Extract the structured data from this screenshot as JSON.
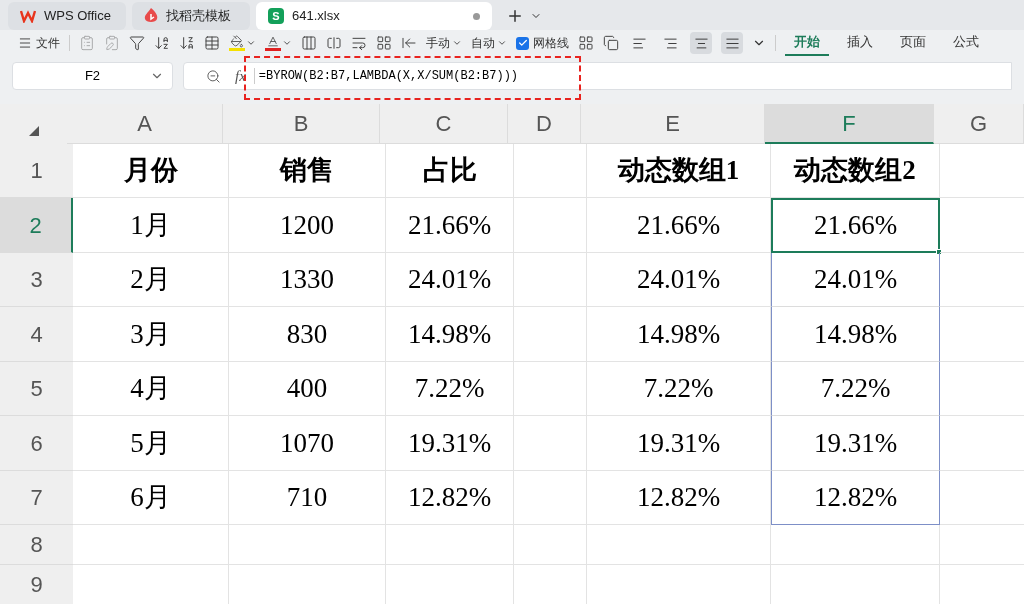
{
  "tabs": [
    {
      "label": "WPS Office",
      "kind": "wps",
      "selected": false
    },
    {
      "label": "找稻壳模板",
      "kind": "docer",
      "selected": false
    },
    {
      "label": "641.xlsx",
      "kind": "sheet",
      "selected": true,
      "icon_letter": "S"
    }
  ],
  "toolbar": {
    "file_label": "文件",
    "row_height_label": "手动",
    "col_width_label": "自动",
    "gridlines": {
      "label": "网格线",
      "checked": true
    },
    "align": [
      {
        "kind": "left",
        "selected": false
      },
      {
        "kind": "right",
        "selected": false
      },
      {
        "kind": "center",
        "selected": true
      },
      {
        "kind": "middle",
        "selected": true
      }
    ],
    "ribbon_tabs": [
      {
        "label": "开始",
        "selected": true
      },
      {
        "label": "插入",
        "selected": false
      },
      {
        "label": "页面",
        "selected": false
      },
      {
        "label": "公式",
        "selected": false
      }
    ]
  },
  "formula_bar": {
    "name_box": "F2",
    "function_label": "fx",
    "formula": "=BYROW(B2:B7,LAMBDA(X,X/SUM(B2:B7)))"
  },
  "columns": [
    {
      "label": "A",
      "selected": false
    },
    {
      "label": "B",
      "selected": false
    },
    {
      "label": "C",
      "selected": false
    },
    {
      "label": "D",
      "selected": false
    },
    {
      "label": "E",
      "selected": false
    },
    {
      "label": "F",
      "selected": true
    },
    {
      "label": "G",
      "selected": false
    }
  ],
  "rows": [
    {
      "label": "1",
      "selected": false,
      "spill": false,
      "cells": [
        "月份",
        "销售",
        "占比",
        null,
        "动态数组1",
        "动态数组2",
        null
      ]
    },
    {
      "label": "2",
      "selected": true,
      "spill": true,
      "cells": [
        "1月",
        "1200",
        "21.66%",
        null,
        "21.66%",
        "21.66%",
        null
      ]
    },
    {
      "label": "3",
      "selected": false,
      "spill": true,
      "cells": [
        "2月",
        "1330",
        "24.01%",
        null,
        "24.01%",
        "24.01%",
        null
      ]
    },
    {
      "label": "4",
      "selected": false,
      "spill": true,
      "cells": [
        "3月",
        "830",
        "14.98%",
        null,
        "14.98%",
        "14.98%",
        null
      ]
    },
    {
      "label": "5",
      "selected": false,
      "spill": true,
      "cells": [
        "4月",
        "400",
        "7.22%",
        null,
        "7.22%",
        "7.22%",
        null
      ]
    },
    {
      "label": "6",
      "selected": false,
      "spill": true,
      "cells": [
        "5月",
        "1070",
        "19.31%",
        null,
        "19.31%",
        "19.31%",
        null
      ]
    },
    {
      "label": "7",
      "selected": false,
      "spill": true,
      "cells": [
        "6月",
        "710",
        "12.82%",
        null,
        "12.82%",
        "12.82%",
        null
      ]
    },
    {
      "label": "8",
      "selected": false,
      "spill": false
    },
    {
      "label": "9",
      "selected": false,
      "spill": false
    }
  ]
}
